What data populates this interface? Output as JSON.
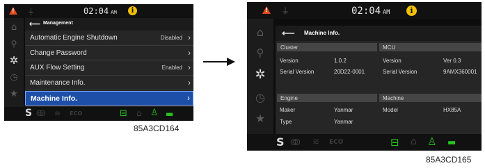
{
  "left_screen": {
    "clock": "02:04",
    "ampm": "AM",
    "header": {
      "back_icon": "back-arrow-icon",
      "title": "Management"
    },
    "menu": [
      {
        "label": "Automatic Engine Shutdown",
        "value": "Disabled"
      },
      {
        "label": "Change Password",
        "value": ""
      },
      {
        "label": "AUX Flow Setting",
        "value": "Enabled"
      },
      {
        "label": "Maintenance Info.",
        "value": ""
      },
      {
        "label": "Machine Info.",
        "value": ""
      }
    ],
    "selected_index": 4,
    "bottom_s": "S",
    "bottom_eco": "ECO",
    "caption": "85A3CD164"
  },
  "right_screen": {
    "clock": "02:04",
    "ampm": "AM",
    "header": {
      "back_icon": "back-arrow-icon",
      "title": "Machine Info."
    },
    "cluster": {
      "title": "Cluster",
      "rows": [
        {
          "label": "Version",
          "value": "1.0.2"
        },
        {
          "label": "Serial Version",
          "value": "20D22-0001"
        }
      ]
    },
    "mcu": {
      "title": "MCU",
      "rows": [
        {
          "label": "Version",
          "value": "Ver 0.3"
        },
        {
          "label": "Serial Version",
          "value": "9AMX360001"
        }
      ]
    },
    "engine": {
      "title": "Engine",
      "rows": [
        {
          "label": "Maker",
          "value": "Yanmar"
        },
        {
          "label": "Type",
          "value": "Yanmar"
        }
      ]
    },
    "machine": {
      "title": "Machine",
      "rows": [
        {
          "label": "Model",
          "value": "HX85A"
        }
      ]
    },
    "bottom_s": "S",
    "bottom_eco": "ECO",
    "caption": "85A3CD165"
  },
  "colors": {
    "warning": "#e34a1b",
    "info": "#f2c200",
    "selected": "#1d4fa8",
    "indicator_green": "#27c21f"
  }
}
